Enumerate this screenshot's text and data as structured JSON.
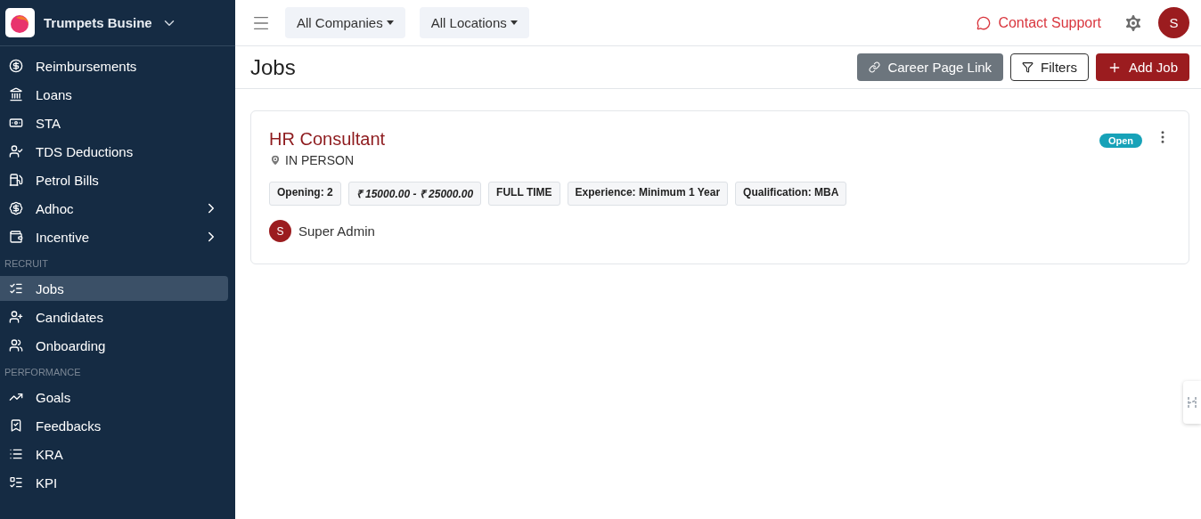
{
  "brand": {
    "name": "Trumpets Busine"
  },
  "sidebar": {
    "groups": [
      {
        "items": [
          {
            "label": "Reimbursements",
            "selected": false
          },
          {
            "label": "Loans",
            "selected": false
          },
          {
            "label": "STA",
            "selected": false
          },
          {
            "label": "TDS Deductions",
            "selected": false
          },
          {
            "label": "Petrol Bills",
            "selected": false
          },
          {
            "label": "Adhoc",
            "selected": false,
            "expanded": false
          },
          {
            "label": "Incentive",
            "selected": false,
            "expanded": false
          }
        ]
      },
      {
        "heading": "RECRUIT",
        "items": [
          {
            "label": "Jobs",
            "selected": true
          },
          {
            "label": "Candidates",
            "selected": false
          },
          {
            "label": "Onboarding",
            "selected": false
          }
        ]
      },
      {
        "heading": "PERFORMANCE",
        "items": [
          {
            "label": "Goals",
            "selected": false
          },
          {
            "label": "Feedbacks",
            "selected": false
          },
          {
            "label": "KRA",
            "selected": false
          },
          {
            "label": "KPI",
            "selected": false
          }
        ]
      }
    ]
  },
  "topbar": {
    "filters": [
      "All Companies",
      "All Locations"
    ],
    "support": "Contact Support",
    "avatar": "S"
  },
  "page": {
    "title": "Jobs",
    "actions": [
      {
        "kind": "link",
        "label": "Career Page Link"
      },
      {
        "kind": "filter",
        "label": "Filters"
      },
      {
        "kind": "add",
        "label": "Add Job"
      }
    ]
  },
  "jobs": [
    {
      "title": "HR Consultant",
      "location": "IN PERSON",
      "status": "Open",
      "tags": [
        {
          "kind": "plain",
          "text": "Opening: 2"
        },
        {
          "kind": "salary",
          "text": "₹ 15000.00 - ₹ 25000.00"
        },
        {
          "kind": "plain",
          "text": "FULL TIME"
        },
        {
          "kind": "plain",
          "text": "Experience: Minimum 1 Year"
        },
        {
          "kind": "plain",
          "text": "Qualification: MBA"
        }
      ],
      "owner": {
        "initial": "S",
        "name": "Super Admin"
      }
    }
  ]
}
